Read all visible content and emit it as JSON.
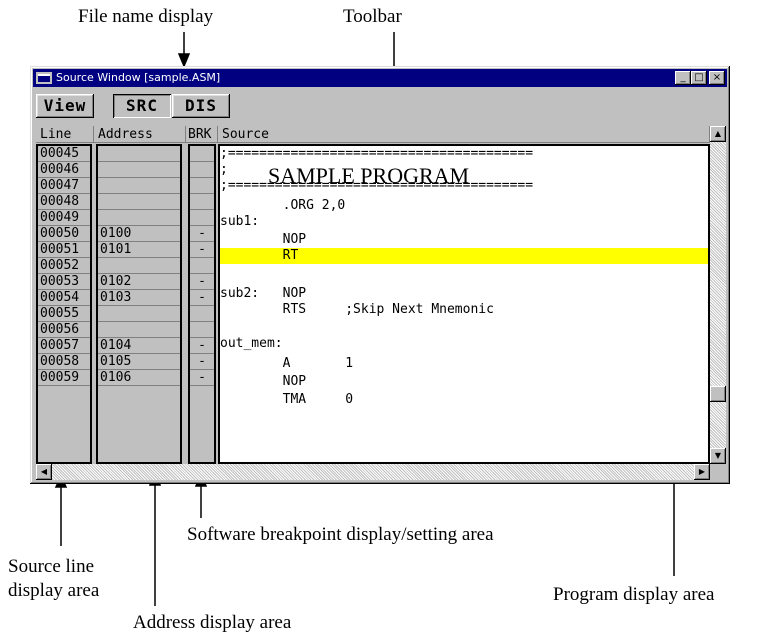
{
  "annotations": {
    "file_name_display": "File name display",
    "toolbar": "Toolbar",
    "brk_area": "Software breakpoint display/setting area",
    "source_line_1": "Source line",
    "source_line_2": "display area",
    "program_area": "Program display area",
    "address_area": "Address display area"
  },
  "window": {
    "title": "Source Window [sample.ASM]",
    "minimize": "_",
    "maximize": "□",
    "close": "×"
  },
  "toolbar": {
    "view": "View",
    "src": "SRC",
    "dis": "DIS"
  },
  "columns": {
    "line": "Line",
    "address": "Address",
    "brk": "BRK",
    "source": "Source"
  },
  "rows": [
    {
      "line": "00045",
      "address": "",
      "brk": "",
      "source": ";======================================="
    },
    {
      "line": "00046",
      "address": "",
      "brk": "",
      "source": ";"
    },
    {
      "line": "00047",
      "address": "",
      "brk": "",
      "source": ";======================================="
    },
    {
      "line": "00048",
      "address": "",
      "brk": "",
      "source": "        .ORG 2,0"
    },
    {
      "line": "00049",
      "address": "",
      "brk": "",
      "source": "sub1:"
    },
    {
      "line": "00050",
      "address": "0100",
      "brk": "-",
      "source": "        NOP"
    },
    {
      "line": "00051",
      "address": "0101",
      "brk": "-",
      "source": "        RT"
    },
    {
      "line": "00052",
      "address": "",
      "brk": "",
      "source": ""
    },
    {
      "line": "00053",
      "address": "0102",
      "brk": "-",
      "source": "sub2:   NOP"
    },
    {
      "line": "00054",
      "address": "0103",
      "brk": "-",
      "source": "        RTS     ;Skip Next Mnemonic"
    },
    {
      "line": "00055",
      "address": "",
      "brk": "",
      "source": ""
    },
    {
      "line": "00056",
      "address": "",
      "brk": "",
      "source": "out_mem:"
    },
    {
      "line": "00057",
      "address": "0104",
      "brk": "-",
      "source": "        A       1"
    },
    {
      "line": "00058",
      "address": "0105",
      "brk": "-",
      "source": "        NOP"
    },
    {
      "line": "00059",
      "address": "0106",
      "brk": "-",
      "source": "        TMA     0"
    }
  ],
  "program_title": "SAMPLE PROGRAM",
  "highlight_color": "#ffff00",
  "scroll": {
    "up": "▲",
    "down": "▼",
    "left": "◀",
    "right": "▶"
  }
}
